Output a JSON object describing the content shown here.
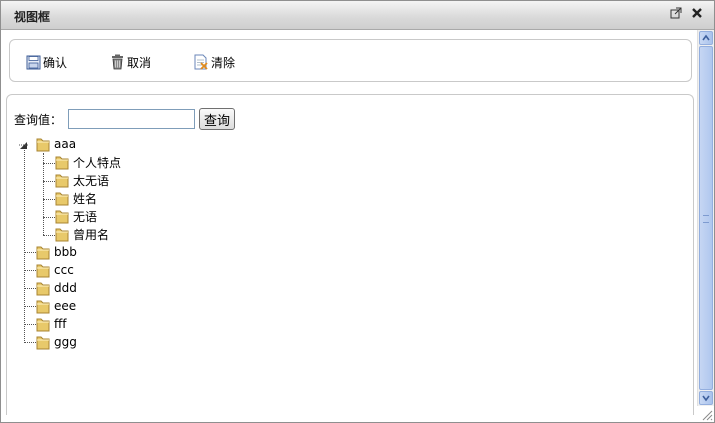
{
  "window": {
    "title": "视图框",
    "popout_icon": "popout-icon",
    "close_icon": "close-icon"
  },
  "toolbar": {
    "confirm_label": "确认",
    "cancel_label": "取消",
    "clear_label": "清除"
  },
  "search": {
    "label": "查询值：",
    "value": "",
    "placeholder": "",
    "button_label": "查询"
  },
  "tree": {
    "root": {
      "label": "aaa",
      "expanded": true,
      "children": [
        "个人特点",
        "太无语",
        "姓名",
        "无语",
        "曾用名"
      ]
    },
    "siblings": [
      "bbb",
      "ccc",
      "ddd",
      "eee",
      "fff",
      "ggg"
    ]
  },
  "colors": {
    "titlebar": "#d9d9d9",
    "scrollbar_accent": "#afc7ee",
    "folder": "#e8c96a"
  }
}
